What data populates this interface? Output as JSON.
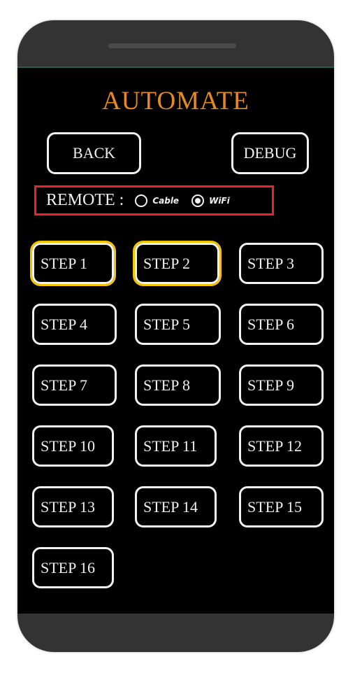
{
  "app": {
    "title": "AUTOMATE"
  },
  "toolbar": {
    "back_label": "BACK",
    "debug_label": "DEBUG"
  },
  "remote": {
    "label": "REMOTE :",
    "options": [
      {
        "label": "Cable",
        "checked": false
      },
      {
        "label": "WiFi",
        "checked": true
      }
    ],
    "highlight_color": "#e8242a"
  },
  "steps": [
    {
      "label": "STEP 1",
      "selected": true
    },
    {
      "label": "STEP 2",
      "selected": true
    },
    {
      "label": "STEP 3",
      "selected": false
    },
    {
      "label": "STEP 4",
      "selected": false
    },
    {
      "label": "STEP 5",
      "selected": false
    },
    {
      "label": "STEP 6",
      "selected": false
    },
    {
      "label": "STEP 7",
      "selected": false
    },
    {
      "label": "STEP 8",
      "selected": false
    },
    {
      "label": "STEP 9",
      "selected": false
    },
    {
      "label": "STEP 10",
      "selected": false
    },
    {
      "label": "STEP 11",
      "selected": false
    },
    {
      "label": "STEP 12",
      "selected": false
    },
    {
      "label": "STEP 13",
      "selected": false
    },
    {
      "label": "STEP 14",
      "selected": false
    },
    {
      "label": "STEP 15",
      "selected": false
    },
    {
      "label": "STEP 16",
      "selected": false
    }
  ],
  "colors": {
    "title": "#e68a1e",
    "selection": "#f5c400",
    "background": "#000000"
  }
}
